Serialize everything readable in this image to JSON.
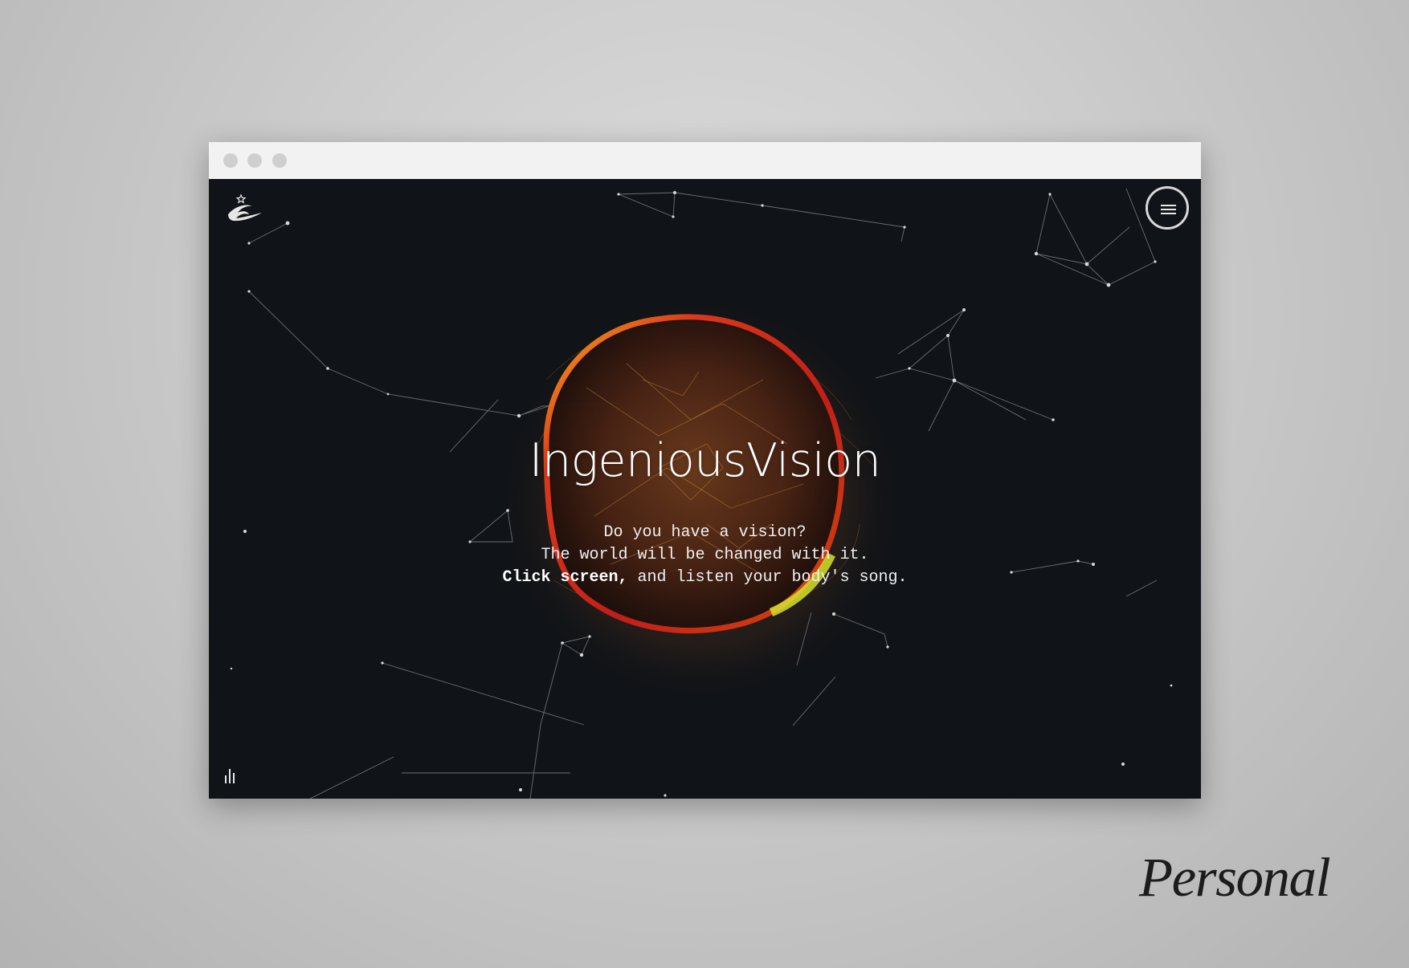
{
  "browser": {
    "window_controls": [
      "close-dot",
      "minimize-dot",
      "maximize-dot"
    ]
  },
  "page": {
    "logo_icon": "ingenious-vision-logo",
    "menu_icon": "hamburger-icon",
    "title": "IngeniousVision",
    "intro": {
      "line1": "Do you have a vision?",
      "line2": "The world will be changed with it.",
      "line3_bold": "Click screen,",
      "line3_rest": " and listen your body's song."
    },
    "audio_icon": "sound-bars-icon"
  },
  "caption": "Personal",
  "colors": {
    "background": "#101317",
    "orb_red": "#d8351e",
    "orb_yellow": "#d6e02a",
    "particles": "#c98a3a"
  }
}
